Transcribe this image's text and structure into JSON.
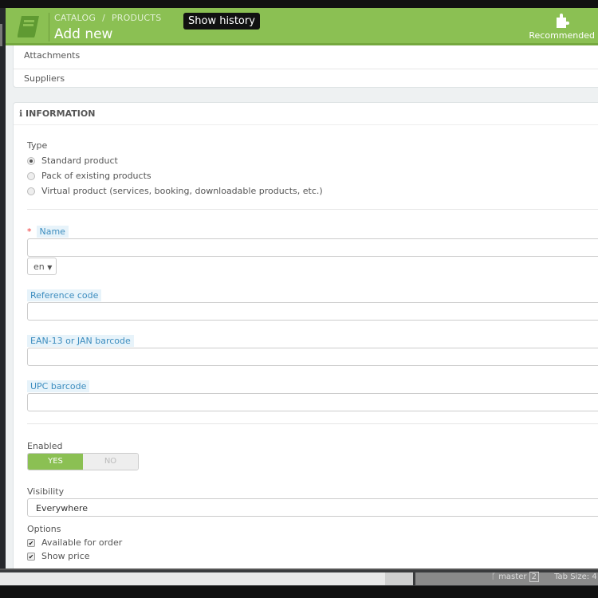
{
  "header": {
    "breadcrumb": [
      "CATALOG",
      "/",
      "PRODUCTS"
    ],
    "title": "Add new",
    "show_history": "Show history",
    "recommended": "Recommended"
  },
  "tabs": {
    "attachments": "Attachments",
    "suppliers": "Suppliers"
  },
  "info": {
    "heading": "INFORMATION",
    "type_label": "Type",
    "types": [
      {
        "label": "Standard product",
        "checked": true
      },
      {
        "label": "Pack of existing products",
        "checked": false
      },
      {
        "label": "Virtual product (services, booking, downloadable products, etc.)",
        "checked": false
      }
    ],
    "required_mark": "*",
    "name_label": "Name",
    "name_value": "",
    "lang": "en",
    "reference_label": "Reference code",
    "ean_label": "EAN-13 or JAN barcode",
    "upc_label": "UPC barcode",
    "enabled_label": "Enabled",
    "yes": "YES",
    "no": "NO",
    "visibility_label": "Visibility",
    "visibility_value": "Everywhere",
    "options_label": "Options",
    "options": [
      {
        "label": "Available for order",
        "checked": true
      },
      {
        "label": "Show price",
        "checked": true
      }
    ]
  },
  "statusbar": {
    "branch": "master",
    "branch_count": "2",
    "tab_size": "Tab Size: 4"
  },
  "colors": {
    "accent": "#8bc053",
    "label_bg": "#e7f3fa"
  }
}
